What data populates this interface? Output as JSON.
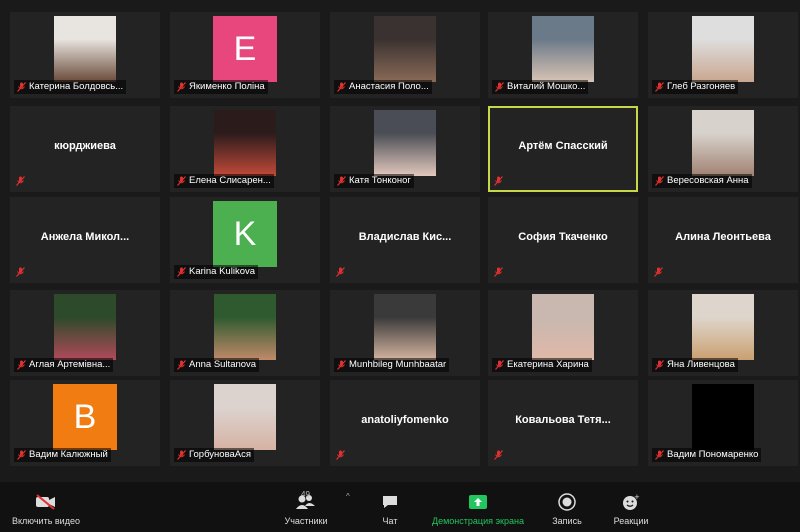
{
  "participants": [
    {
      "name": "Катерина Болдовсь...",
      "kind": "photo",
      "colors": [
        "#e8e4df",
        "#6a4a3a"
      ]
    },
    {
      "name": "Якименко Поліна",
      "kind": "avatar",
      "letter": "E",
      "color": "#e8477d"
    },
    {
      "name": "Анастасия Поло...",
      "kind": "photo",
      "colors": [
        "#3a3230",
        "#8a6a58"
      ]
    },
    {
      "name": "Виталий Мошко...",
      "kind": "photo",
      "colors": [
        "#6a7a88",
        "#d9c3b5"
      ]
    },
    {
      "name": "Глеб Разгоняев",
      "kind": "photo",
      "colors": [
        "#dedede",
        "#c9a68f"
      ]
    },
    {
      "name": "кюрджиева",
      "kind": "text"
    },
    {
      "name": "Елена Слисарен...",
      "kind": "photo",
      "colors": [
        "#2b1b1b",
        "#c24a3a"
      ]
    },
    {
      "name": "Катя Тонконог",
      "kind": "photo",
      "colors": [
        "#4a4d55",
        "#e2c8bd"
      ]
    },
    {
      "name": "Артём Спасский",
      "kind": "text",
      "active": true
    },
    {
      "name": "Вересовская Анна",
      "kind": "photo",
      "colors": [
        "#d8d2cc",
        "#a08272"
      ]
    },
    {
      "name": "Анжела Микол...",
      "kind": "text"
    },
    {
      "name": "Karina Kulikova",
      "kind": "avatar",
      "letter": "K",
      "color": "#4caf50"
    },
    {
      "name": "Владислав Кис...",
      "kind": "text"
    },
    {
      "name": "София Ткаченко",
      "kind": "text"
    },
    {
      "name": "Алина Леонтьева",
      "kind": "text"
    },
    {
      "name": "Аглая Артемівна...",
      "kind": "photo",
      "colors": [
        "#2d4a2a",
        "#b04a5a"
      ]
    },
    {
      "name": "Anna Sultanova",
      "kind": "photo",
      "colors": [
        "#2f5a2f",
        "#c08a6a"
      ]
    },
    {
      "name": "Munhbileg Munhbaatar",
      "kind": "photo",
      "colors": [
        "#3a3a3a",
        "#d4b4a0"
      ]
    },
    {
      "name": "Екатерина Харина",
      "kind": "photo",
      "colors": [
        "#c8b8b0",
        "#e0b8a8"
      ]
    },
    {
      "name": "Яна Ливенцова",
      "kind": "photo",
      "colors": [
        "#ded6cc",
        "#caa070"
      ]
    },
    {
      "name": "Вадим Калюжный",
      "kind": "avatar",
      "letter": "B",
      "color": "#f07c12"
    },
    {
      "name": "ГорбуноваАся",
      "kind": "photo",
      "colors": [
        "#dcd3cf",
        "#d6b2a4"
      ]
    },
    {
      "name": "anatoliyfomenko",
      "kind": "text"
    },
    {
      "name": "Ковальова Тетя...",
      "kind": "text"
    },
    {
      "name": "Вадим Пономаренко",
      "kind": "blank",
      "color": "#000000"
    }
  ],
  "toolbar": {
    "video": "Включить видео",
    "participants": "Участники",
    "participants_count": "49",
    "chat": "Чат",
    "share": "Демонстрация экрана",
    "record": "Запись",
    "reactions": "Реакции"
  },
  "colors": {
    "share": "#22c55e",
    "muted": "#e03030",
    "active_border": "#c6d84a"
  }
}
